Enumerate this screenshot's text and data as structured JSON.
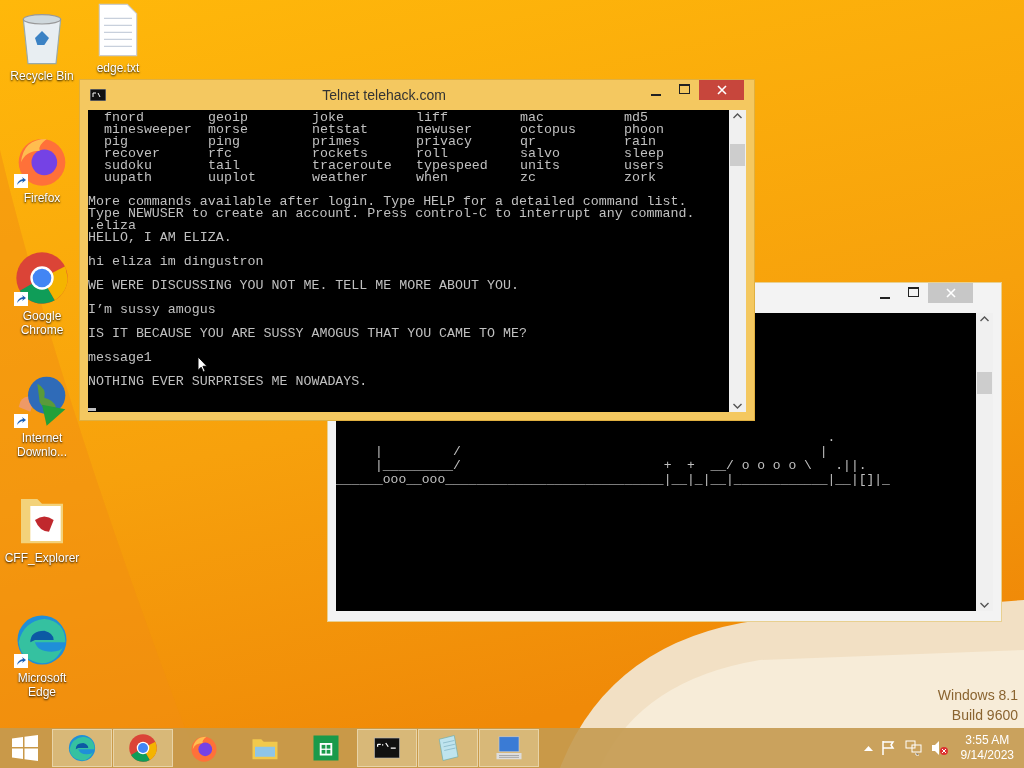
{
  "desktop_icons": [
    {
      "kind": "recycle",
      "label": "Recycle Bin",
      "shortcut": false
    },
    {
      "kind": "textfile",
      "label": "edge.txt",
      "shortcut": false
    },
    {
      "kind": "firefox",
      "label": "Firefox",
      "shortcut": true
    },
    {
      "kind": "chrome",
      "label": "Google Chrome",
      "shortcut": true
    },
    {
      "kind": "idm",
      "label": "Internet Downlo...",
      "shortcut": true
    },
    {
      "kind": "folder",
      "label": "CFF_Explorer",
      "shortcut": false
    },
    {
      "kind": "edge",
      "label": "Microsoft Edge",
      "shortcut": true
    }
  ],
  "console_window": {
    "active": false,
    "art_lines": [
      "                                                               .",
      "     |         /                                              |",
      "     |_________/                          +  +  __/ o o o o \\   .||.",
      "______ooo__ooo____________________________|__|_|__|____________|__|[]|_"
    ]
  },
  "telnet_window": {
    "title": "Telnet telehack.com",
    "active": true,
    "commands": [
      [
        "fnord",
        "geoip",
        "joke",
        "liff",
        "mac",
        "md5"
      ],
      [
        "minesweeper",
        "morse",
        "netstat",
        "newuser",
        "octopus",
        "phoon"
      ],
      [
        "pig",
        "ping",
        "primes",
        "privacy",
        "qr",
        "rain"
      ],
      [
        "recover",
        "rfc",
        "rockets",
        "roll",
        "salvo",
        "sleep"
      ],
      [
        "sudoku",
        "tail",
        "traceroute",
        "typespeed",
        "units",
        "users"
      ],
      [
        "uupath",
        "uuplot",
        "weather",
        "when",
        "zc",
        "zork"
      ]
    ],
    "blocks": [
      [
        "More commands available after login. Type HELP for a detailed command list.",
        "Type NEWUSER to create an account. Press control-C to interrupt any command.",
        ".eliza",
        "HELLO, I AM ELIZA."
      ],
      [
        "hi eliza im dingustron"
      ],
      [
        "WE WERE DISCUSSING YOU NOT ME. TELL ME MORE ABOUT YOU."
      ],
      [
        "I’m sussy amogus"
      ],
      [
        "IS IT BECAUSE YOU ARE SUSSY AMOGUS THAT YOU CAME TO ME?"
      ],
      [
        "message1"
      ],
      [
        "NOTHING EVER SURPRISES ME NOWADAYS."
      ]
    ]
  },
  "watermark": [
    "Windows 8.1",
    "Build 9600"
  ],
  "taskbar": {
    "apps": [
      {
        "kind": "edge",
        "running": true
      },
      {
        "kind": "chrome",
        "running": true
      },
      {
        "kind": "firefox",
        "running": false
      },
      {
        "kind": "explorer",
        "running": false
      },
      {
        "kind": "store",
        "running": false
      },
      {
        "kind": "cmd",
        "running": true
      },
      {
        "kind": "notepad",
        "running": true
      },
      {
        "kind": "network",
        "running": true
      }
    ],
    "time": "3:55 AM",
    "date": "9/14/2023"
  }
}
